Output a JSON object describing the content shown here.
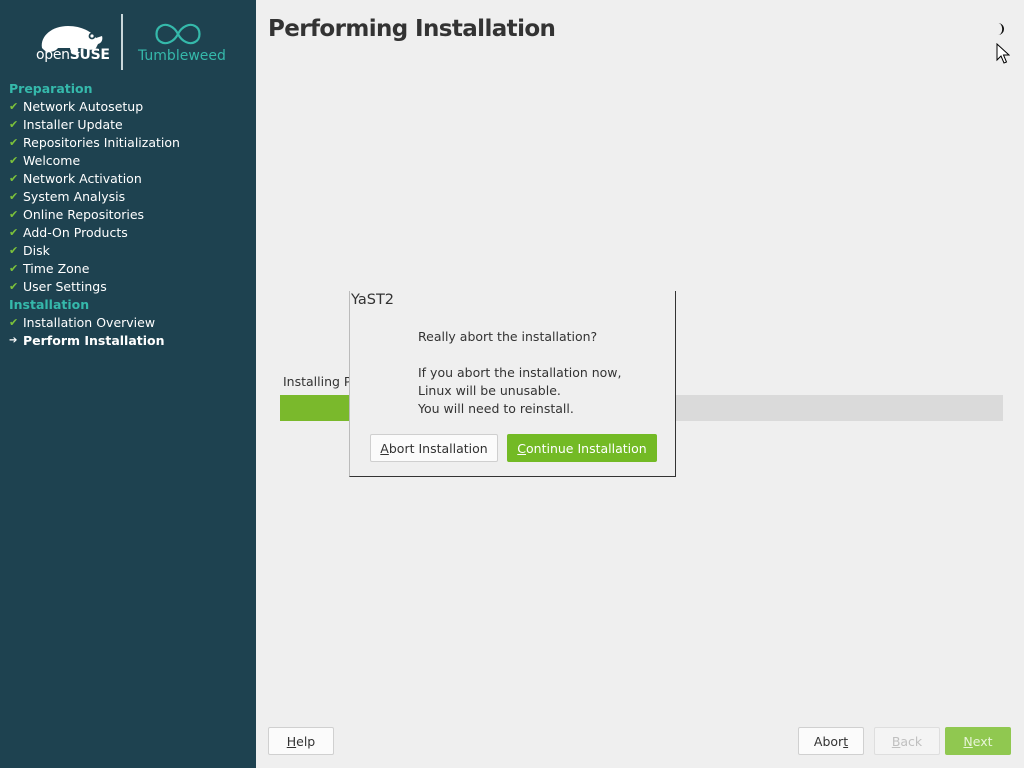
{
  "brand": {
    "suse_prefix": "open",
    "suse_name": "SUSE",
    "product": "Tumbleweed"
  },
  "sidebar": {
    "sections": [
      {
        "title": "Preparation",
        "items": [
          {
            "label": "Network Autosetup",
            "state": "done"
          },
          {
            "label": "Installer Update",
            "state": "done"
          },
          {
            "label": "Repositories Initialization",
            "state": "done"
          },
          {
            "label": "Welcome",
            "state": "done"
          },
          {
            "label": "Network Activation",
            "state": "done"
          },
          {
            "label": "System Analysis",
            "state": "done"
          },
          {
            "label": "Online Repositories",
            "state": "done"
          },
          {
            "label": "Add-On Products",
            "state": "done"
          },
          {
            "label": "Disk",
            "state": "done"
          },
          {
            "label": "Time Zone",
            "state": "done"
          },
          {
            "label": "User Settings",
            "state": "done"
          }
        ]
      },
      {
        "title": "Installation",
        "items": [
          {
            "label": "Installation Overview",
            "state": "done"
          },
          {
            "label": "Perform Installation",
            "state": "current"
          }
        ]
      }
    ]
  },
  "main": {
    "title": "Performing Installation",
    "progress_label": "Installing Pa",
    "progress_fraction": 0.095
  },
  "dialog": {
    "title": "YaST2",
    "question": "Really abort the installation?",
    "detail_lines": [
      "If you abort the installation now,",
      "Linux will be unusable.",
      "You will need to reinstall."
    ],
    "abort_button": {
      "accel": "A",
      "rest": "bort Installation"
    },
    "continue_button": {
      "accel": "C",
      "rest": "ontinue Installation"
    }
  },
  "footer": {
    "help": {
      "accel": "H",
      "rest": "elp"
    },
    "abort": {
      "pre": "Abor",
      "accel": "t",
      "rest": ""
    },
    "back": {
      "accel": "B",
      "rest": "ack"
    },
    "next": {
      "accel": "N",
      "rest": "ext"
    }
  },
  "icons": {
    "done": "checkmark-icon",
    "current": "arrow-right-icon",
    "theme": "half-moon-icon"
  },
  "colors": {
    "sidebar_bg": "#1e4250",
    "section_title": "#35b9ab",
    "check": "#7cc23a",
    "primary_button": "#73ba25",
    "progress": "#7ab92c"
  }
}
